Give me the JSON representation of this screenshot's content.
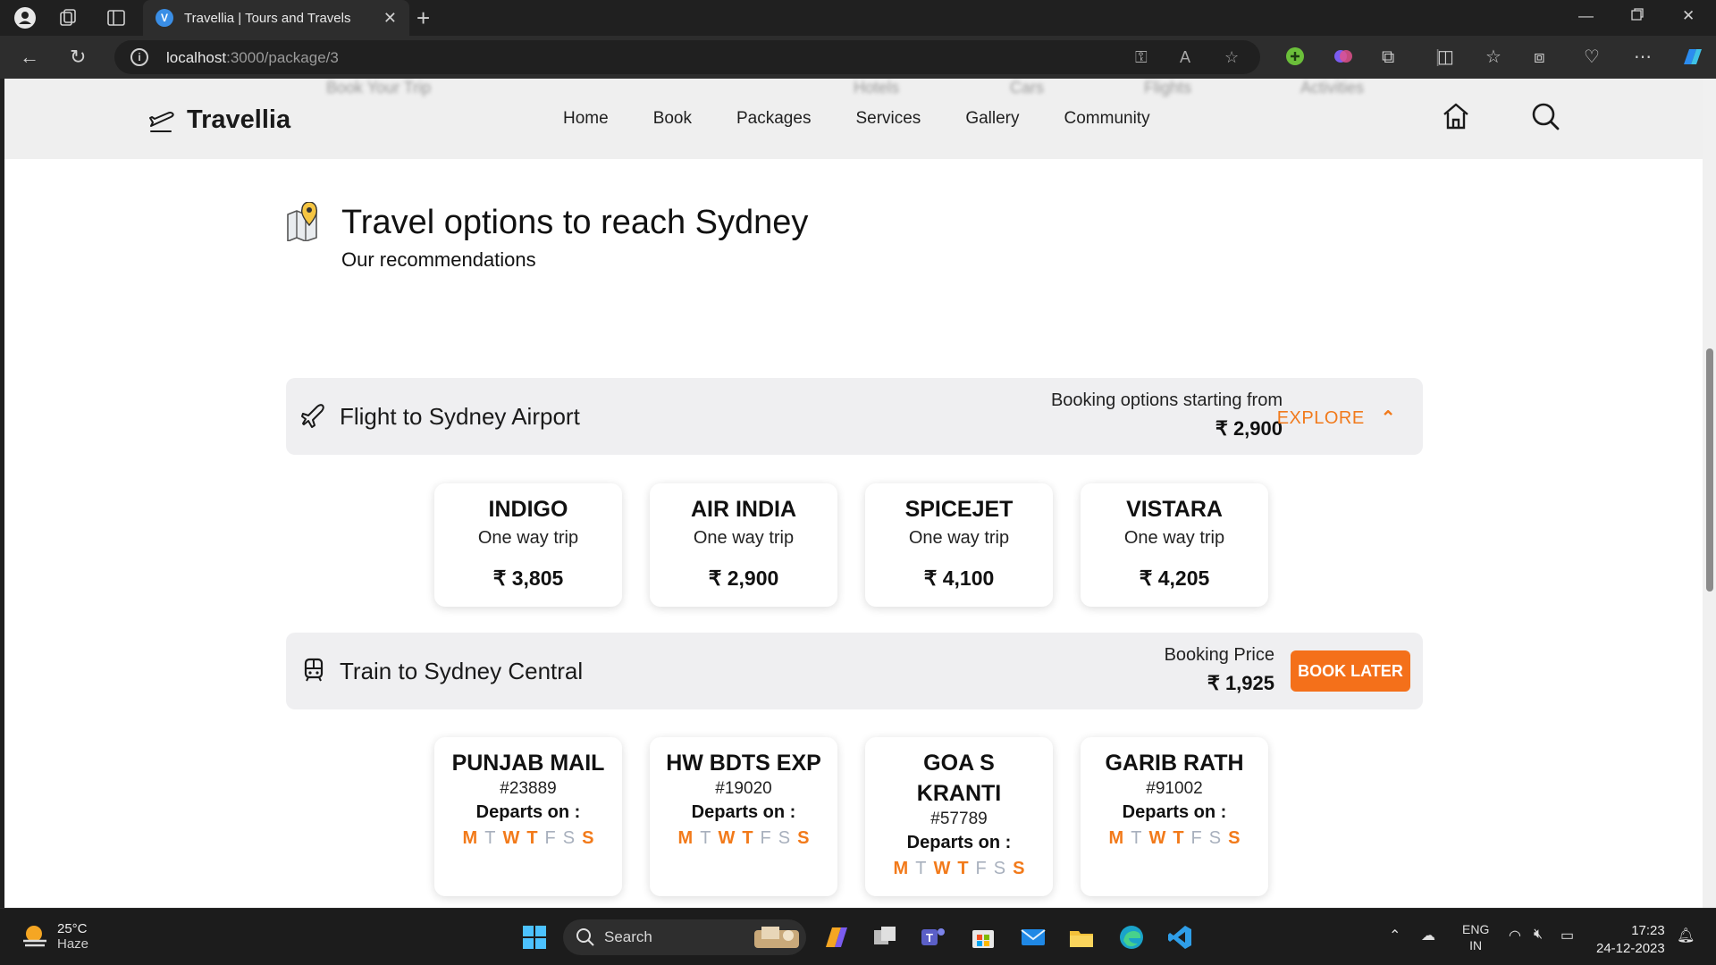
{
  "browser": {
    "tab_title": "Travellia | Tours and Travels",
    "tab_favicon_letter": "V",
    "url_host": "localhost",
    "url_path": ":3000/package/3"
  },
  "site": {
    "logo_text": "Travellia",
    "nav": [
      "Home",
      "Book",
      "Packages",
      "Services",
      "Gallery",
      "Community"
    ],
    "behind_header": [
      "Book Your Trip",
      "Hotels",
      "Cars",
      "Flights",
      "Activities"
    ]
  },
  "section": {
    "title": "Travel options to reach Sydney",
    "subtitle": "Our recommendations"
  },
  "flight": {
    "title": "Flight to Sydney Airport",
    "label": "Booking options starting from",
    "price": "₹ 2,900",
    "action": "EXPLORE",
    "action_icon": "chevron-up-icon",
    "options": [
      {
        "name": "INDIGO",
        "trip": "One way trip",
        "price": "₹ 3,805"
      },
      {
        "name": "AIR INDIA",
        "trip": "One way trip",
        "price": "₹ 2,900"
      },
      {
        "name": "SPICEJET",
        "trip": "One way trip",
        "price": "₹ 4,100"
      },
      {
        "name": "VISTARA",
        "trip": "One way trip",
        "price": "₹ 4,205"
      }
    ]
  },
  "train": {
    "title": "Train to Sydney Central",
    "label": "Booking Price",
    "price": "₹ 1,925",
    "action": "BOOK LATER",
    "departs_label": "Departs on :",
    "days": [
      "M",
      "T",
      "W",
      "T",
      "F",
      "S",
      "S"
    ],
    "active_days": [
      true,
      false,
      true,
      true,
      false,
      false,
      true
    ],
    "options": [
      {
        "name": "PUNJAB MAIL",
        "number": "#23889"
      },
      {
        "name": "HW BDTS EXP",
        "number": "#19020"
      },
      {
        "name": "GOA S KRANTI",
        "number": "#57789"
      },
      {
        "name": "GARIB RATH",
        "number": "#91002"
      }
    ]
  },
  "taskbar": {
    "temp": "25°C",
    "condition": "Haze",
    "search": "Search",
    "lang_1": "ENG",
    "lang_2": "IN",
    "time": "17:23",
    "date": "24-12-2023"
  },
  "colors": {
    "accent": "#f17a1c",
    "button": "#f4701a",
    "inactive_day": "#a8b0bd"
  }
}
